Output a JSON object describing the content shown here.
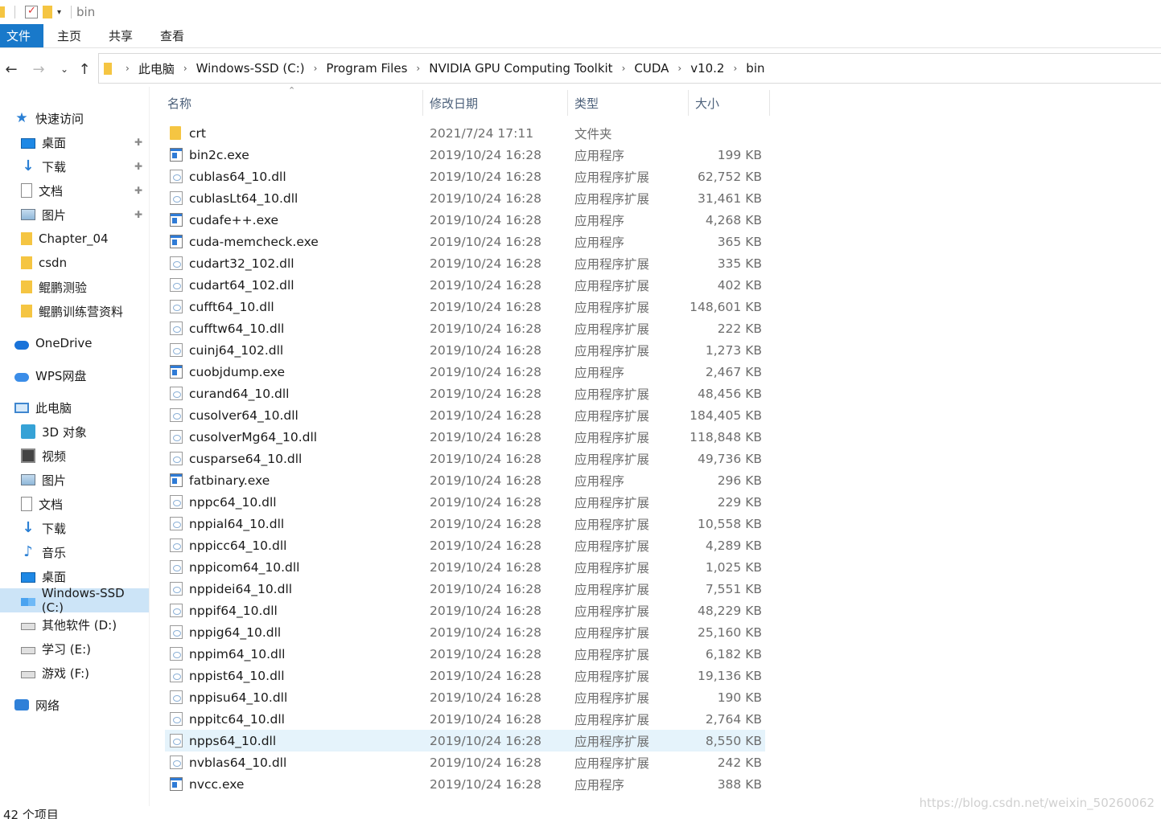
{
  "window": {
    "title": "bin"
  },
  "ribbon": {
    "tabs": [
      "文件",
      "主页",
      "共享",
      "查看"
    ]
  },
  "address": {
    "crumbs": [
      "此电脑",
      "Windows-SSD (C:)",
      "Program Files",
      "NVIDIA GPU Computing Toolkit",
      "CUDA",
      "v10.2",
      "bin"
    ]
  },
  "columns": {
    "name": "名称",
    "date": "修改日期",
    "type": "类型",
    "size": "大小"
  },
  "sidebar": {
    "items": [
      {
        "label": "快速访问",
        "icon": "star-icon",
        "pin": false
      },
      {
        "label": "桌面",
        "icon": "desktop-icon",
        "pin": true
      },
      {
        "label": "下载",
        "icon": "download-icon",
        "pin": true
      },
      {
        "label": "文档",
        "icon": "document-icon",
        "pin": true
      },
      {
        "label": "图片",
        "icon": "pictures-icon",
        "pin": true
      },
      {
        "label": "Chapter_04",
        "icon": "folder-icon",
        "pin": false
      },
      {
        "label": "csdn",
        "icon": "folder-icon",
        "pin": false
      },
      {
        "label": "鲲鹏测验",
        "icon": "folder-icon",
        "pin": false
      },
      {
        "label": "鲲鹏训练营资料",
        "icon": "folder-icon",
        "pin": false
      },
      {
        "label": "OneDrive",
        "icon": "onedrive-icon",
        "pin": false
      },
      {
        "label": "WPS网盘",
        "icon": "wps-cloud-icon",
        "pin": false
      },
      {
        "label": "此电脑",
        "icon": "this-pc-icon",
        "pin": false
      },
      {
        "label": "3D 对象",
        "icon": "3d-objects-icon",
        "pin": false
      },
      {
        "label": "视频",
        "icon": "video-icon",
        "pin": false
      },
      {
        "label": "图片",
        "icon": "pictures-icon",
        "pin": false
      },
      {
        "label": "文档",
        "icon": "document-icon",
        "pin": false
      },
      {
        "label": "下载",
        "icon": "download-icon",
        "pin": false
      },
      {
        "label": "音乐",
        "icon": "music-icon",
        "pin": false
      },
      {
        "label": "桌面",
        "icon": "desktop-icon",
        "pin": false
      },
      {
        "label": "Windows-SSD (C:)",
        "icon": "windows-drive-icon",
        "pin": false
      },
      {
        "label": "其他软件 (D:)",
        "icon": "drive-icon",
        "pin": false
      },
      {
        "label": "学习 (E:)",
        "icon": "drive-icon",
        "pin": false
      },
      {
        "label": "游戏 (F:)",
        "icon": "drive-icon",
        "pin": false
      },
      {
        "label": "网络",
        "icon": "network-icon",
        "pin": false
      }
    ]
  },
  "files": [
    {
      "name": "crt",
      "date": "2021/7/24 17:11",
      "type": "文件夹",
      "size": "",
      "kind": "folder"
    },
    {
      "name": "bin2c.exe",
      "date": "2019/10/24 16:28",
      "type": "应用程序",
      "size": "199 KB",
      "kind": "exe"
    },
    {
      "name": "cublas64_10.dll",
      "date": "2019/10/24 16:28",
      "type": "应用程序扩展",
      "size": "62,752 KB",
      "kind": "dll"
    },
    {
      "name": "cublasLt64_10.dll",
      "date": "2019/10/24 16:28",
      "type": "应用程序扩展",
      "size": "31,461 KB",
      "kind": "dll"
    },
    {
      "name": "cudafe++.exe",
      "date": "2019/10/24 16:28",
      "type": "应用程序",
      "size": "4,268 KB",
      "kind": "exe"
    },
    {
      "name": "cuda-memcheck.exe",
      "date": "2019/10/24 16:28",
      "type": "应用程序",
      "size": "365 KB",
      "kind": "exe"
    },
    {
      "name": "cudart32_102.dll",
      "date": "2019/10/24 16:28",
      "type": "应用程序扩展",
      "size": "335 KB",
      "kind": "dll"
    },
    {
      "name": "cudart64_102.dll",
      "date": "2019/10/24 16:28",
      "type": "应用程序扩展",
      "size": "402 KB",
      "kind": "dll"
    },
    {
      "name": "cufft64_10.dll",
      "date": "2019/10/24 16:28",
      "type": "应用程序扩展",
      "size": "148,601 KB",
      "kind": "dll"
    },
    {
      "name": "cufftw64_10.dll",
      "date": "2019/10/24 16:28",
      "type": "应用程序扩展",
      "size": "222 KB",
      "kind": "dll"
    },
    {
      "name": "cuinj64_102.dll",
      "date": "2019/10/24 16:28",
      "type": "应用程序扩展",
      "size": "1,273 KB",
      "kind": "dll"
    },
    {
      "name": "cuobjdump.exe",
      "date": "2019/10/24 16:28",
      "type": "应用程序",
      "size": "2,467 KB",
      "kind": "exe"
    },
    {
      "name": "curand64_10.dll",
      "date": "2019/10/24 16:28",
      "type": "应用程序扩展",
      "size": "48,456 KB",
      "kind": "dll"
    },
    {
      "name": "cusolver64_10.dll",
      "date": "2019/10/24 16:28",
      "type": "应用程序扩展",
      "size": "184,405 KB",
      "kind": "dll"
    },
    {
      "name": "cusolverMg64_10.dll",
      "date": "2019/10/24 16:28",
      "type": "应用程序扩展",
      "size": "118,848 KB",
      "kind": "dll"
    },
    {
      "name": "cusparse64_10.dll",
      "date": "2019/10/24 16:28",
      "type": "应用程序扩展",
      "size": "49,736 KB",
      "kind": "dll"
    },
    {
      "name": "fatbinary.exe",
      "date": "2019/10/24 16:28",
      "type": "应用程序",
      "size": "296 KB",
      "kind": "exe"
    },
    {
      "name": "nppc64_10.dll",
      "date": "2019/10/24 16:28",
      "type": "应用程序扩展",
      "size": "229 KB",
      "kind": "dll"
    },
    {
      "name": "nppial64_10.dll",
      "date": "2019/10/24 16:28",
      "type": "应用程序扩展",
      "size": "10,558 KB",
      "kind": "dll"
    },
    {
      "name": "nppicc64_10.dll",
      "date": "2019/10/24 16:28",
      "type": "应用程序扩展",
      "size": "4,289 KB",
      "kind": "dll"
    },
    {
      "name": "nppicom64_10.dll",
      "date": "2019/10/24 16:28",
      "type": "应用程序扩展",
      "size": "1,025 KB",
      "kind": "dll"
    },
    {
      "name": "nppidei64_10.dll",
      "date": "2019/10/24 16:28",
      "type": "应用程序扩展",
      "size": "7,551 KB",
      "kind": "dll"
    },
    {
      "name": "nppif64_10.dll",
      "date": "2019/10/24 16:28",
      "type": "应用程序扩展",
      "size": "48,229 KB",
      "kind": "dll"
    },
    {
      "name": "nppig64_10.dll",
      "date": "2019/10/24 16:28",
      "type": "应用程序扩展",
      "size": "25,160 KB",
      "kind": "dll"
    },
    {
      "name": "nppim64_10.dll",
      "date": "2019/10/24 16:28",
      "type": "应用程序扩展",
      "size": "6,182 KB",
      "kind": "dll"
    },
    {
      "name": "nppist64_10.dll",
      "date": "2019/10/24 16:28",
      "type": "应用程序扩展",
      "size": "19,136 KB",
      "kind": "dll"
    },
    {
      "name": "nppisu64_10.dll",
      "date": "2019/10/24 16:28",
      "type": "应用程序扩展",
      "size": "190 KB",
      "kind": "dll"
    },
    {
      "name": "nppitc64_10.dll",
      "date": "2019/10/24 16:28",
      "type": "应用程序扩展",
      "size": "2,764 KB",
      "kind": "dll"
    },
    {
      "name": "npps64_10.dll",
      "date": "2019/10/24 16:28",
      "type": "应用程序扩展",
      "size": "8,550 KB",
      "kind": "dll",
      "highlighted": true
    },
    {
      "name": "nvblas64_10.dll",
      "date": "2019/10/24 16:28",
      "type": "应用程序扩展",
      "size": "242 KB",
      "kind": "dll"
    },
    {
      "name": "nvcc.exe",
      "date": "2019/10/24 16:28",
      "type": "应用程序",
      "size": "388 KB",
      "kind": "exe"
    }
  ],
  "status": {
    "count": "42 个项目"
  },
  "watermark": "https://blog.csdn.net/weixin_50260062",
  "colors": {
    "accent": "#1979ca",
    "hover": "#e5f3fb",
    "selected": "#cce4f7"
  }
}
